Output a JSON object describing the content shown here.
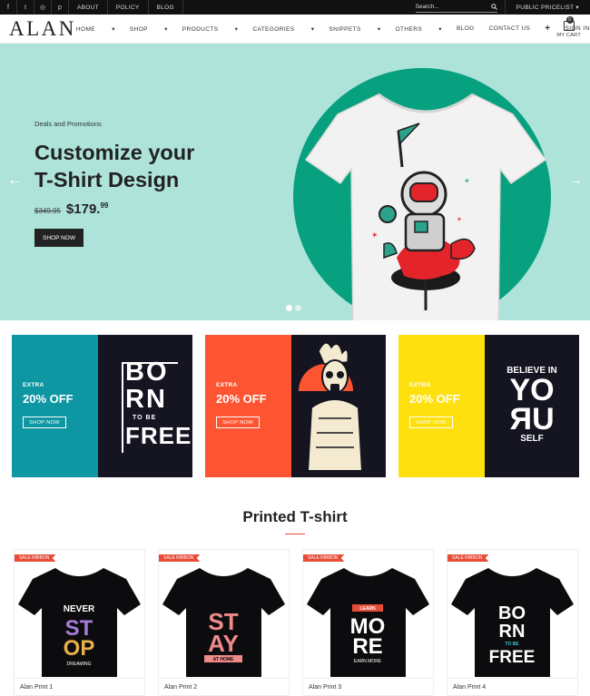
{
  "topbar": {
    "social_icons": [
      "facebook-icon",
      "twitter-icon",
      "instagram-icon",
      "pinterest-icon"
    ],
    "social_glyphs": [
      "f",
      "t",
      "◎",
      "p"
    ],
    "links": [
      "ABOUT",
      "POLICY",
      "BLOG"
    ],
    "search_placeholder": "Search...",
    "pricelist": "PUBLIC PRICELIST"
  },
  "header": {
    "logo": "ALAN",
    "nav": [
      "HOME",
      "SHOP",
      "PRODUCTS",
      "CATEGORIES",
      "SNIPPETS",
      "OTHERS",
      "BLOG",
      "CONTACT US"
    ],
    "nav_dropdown": [
      true,
      true,
      true,
      true,
      true,
      true,
      false,
      false
    ],
    "signin": "SIGN IN",
    "cart_label": "MY CART",
    "cart_count": "0"
  },
  "hero": {
    "kicker": "Deals and Promotions",
    "title_line1": "Customize your",
    "title_line2": "T-Shirt Design",
    "old_price": "$349.95",
    "new_price": "$179.",
    "new_price_cents": "99",
    "button": "SHOP NOW",
    "slides": 2,
    "active_slide": 0,
    "bg_color": "#aee3da",
    "circle_color": "#07a180"
  },
  "promos": [
    {
      "extra": "EXTRA",
      "discount": "20% OFF",
      "button": "SHOP NOW",
      "color": "#0e97a2",
      "art_lines": [
        "BO",
        "RN",
        "TO BE",
        "FREE"
      ]
    },
    {
      "extra": "EXTRA",
      "discount": "20% OFF",
      "button": "SHOP NOW",
      "color": "#fd5531",
      "art_lines": []
    },
    {
      "extra": "EXTRA",
      "discount": "20% OFF",
      "button": "SHOP NOW",
      "color": "#fee00f",
      "art_lines": [
        "BELIEVE IN",
        "YO",
        "UR",
        "SELF"
      ]
    }
  ],
  "section": {
    "title": "Printed T-shirt"
  },
  "products": [
    {
      "ribbon": "SALE RIBBON",
      "name": "Alan Print 1",
      "print_lines": [
        "NEVER",
        "ST",
        "OP",
        "DREAMING"
      ]
    },
    {
      "ribbon": "SALE RIBBON",
      "name": "Alan Print 2",
      "print_lines": [
        "ST",
        "AY",
        "AT HOME"
      ]
    },
    {
      "ribbon": "SALE RIBBON",
      "name": "Alan Print 3",
      "print_lines": [
        "LEARN",
        "MO",
        "RE",
        "EARN MORE"
      ]
    },
    {
      "ribbon": "SALE RIBBON",
      "name": "Alan Print 4",
      "print_lines": [
        "BO",
        "RN",
        "TO BE",
        "FREE"
      ]
    }
  ]
}
